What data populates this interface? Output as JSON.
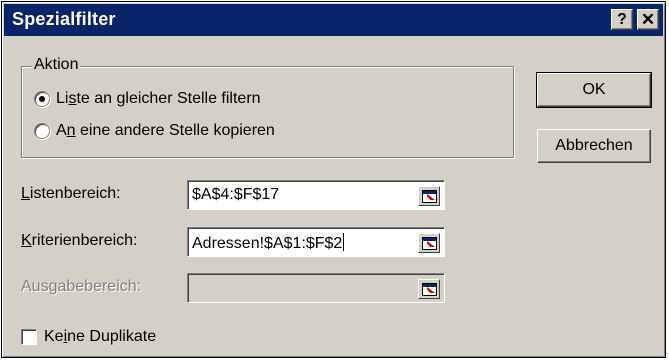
{
  "window": {
    "title": "Spezialfilter",
    "help_glyph": "?",
    "close_glyph": "✕",
    "colors": {
      "titlebar": "#0a246a",
      "face": "#d4d0c8"
    }
  },
  "action_group": {
    "legend": "Aktion",
    "options": [
      {
        "pre": "Li",
        "accel": "s",
        "post": "te an gleicher Stelle filtern",
        "checked": true
      },
      {
        "pre": "A",
        "accel": "n",
        "post": " eine andere Stelle kopieren",
        "checked": false
      }
    ]
  },
  "buttons": {
    "ok": "OK",
    "cancel": "Abbrechen"
  },
  "fields": {
    "list_range": {
      "accel": "L",
      "label_rest": "istenbereich:",
      "value": "$A$4:$F$17",
      "enabled": true
    },
    "criteria_range": {
      "accel": "K",
      "label_rest": "riterienbereich:",
      "value": "Adressen!$A$1:$F$2",
      "enabled": true
    },
    "output_range": {
      "label": "Ausgabebereich:",
      "value": "",
      "enabled": false
    }
  },
  "no_duplicates": {
    "pre": "Ke",
    "accel": "i",
    "post": "ne Duplikate",
    "checked": false
  },
  "icons": {
    "ref_button": "collapse-dialog-icon"
  }
}
